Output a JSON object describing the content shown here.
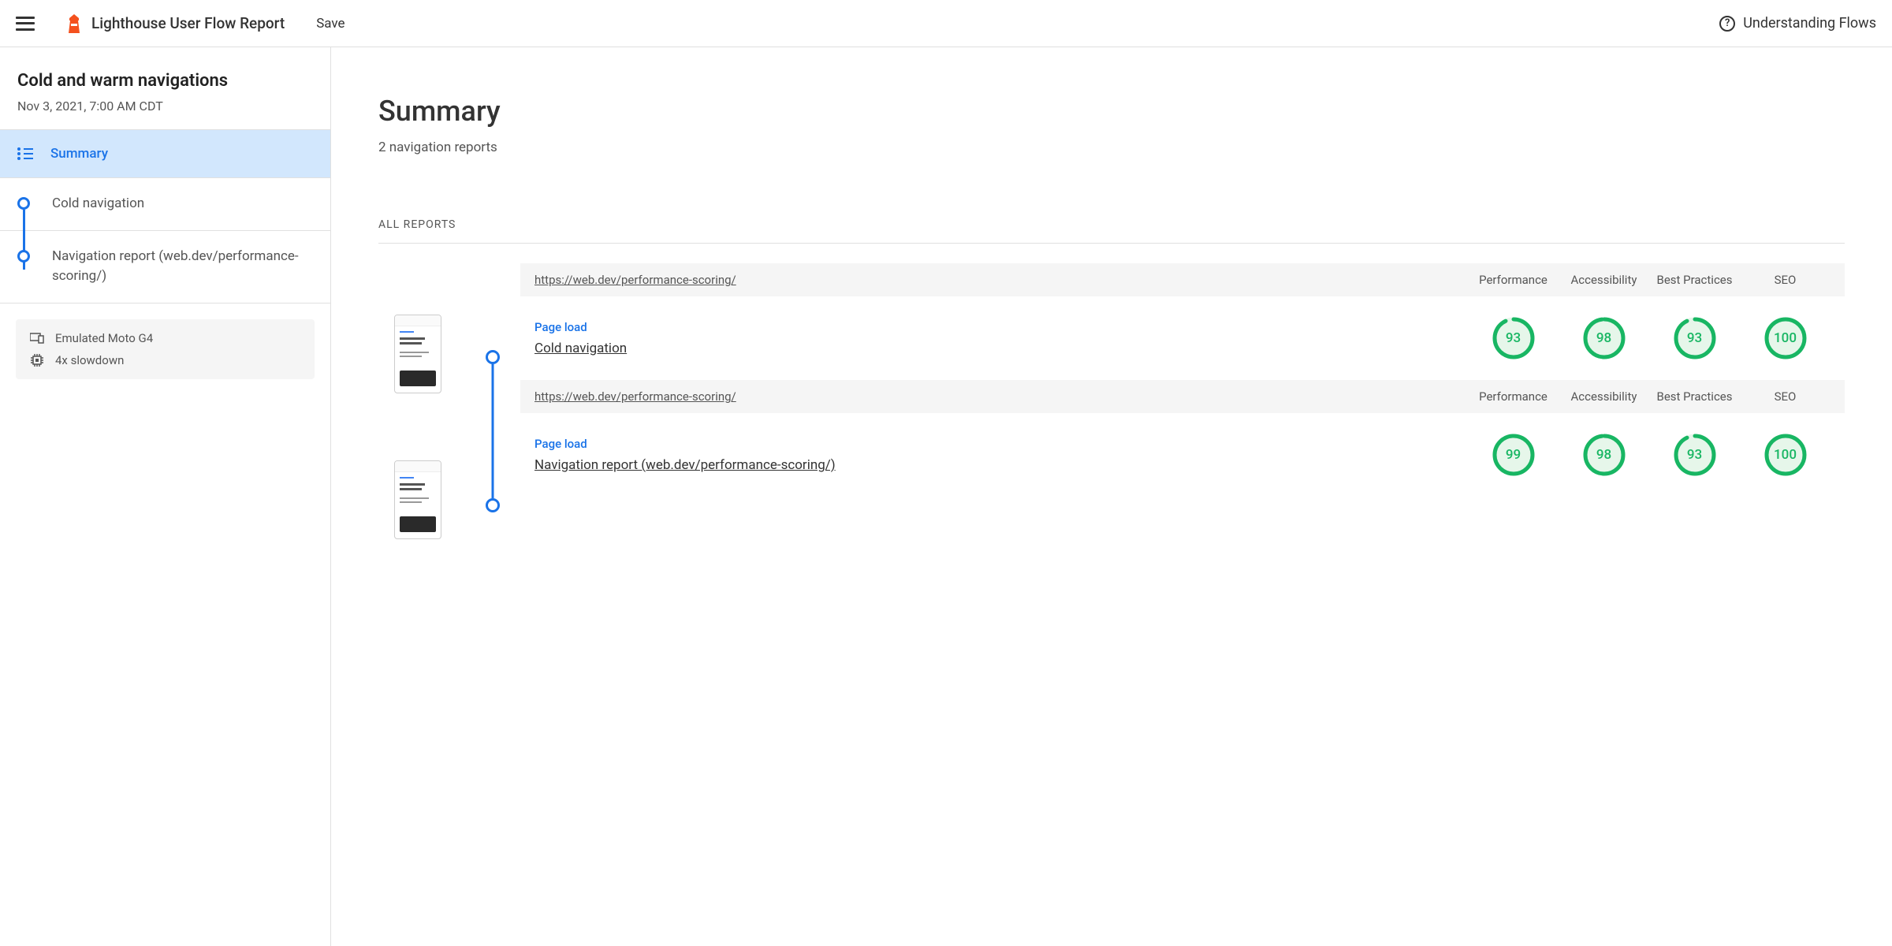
{
  "header": {
    "app_title": "Lighthouse User Flow Report",
    "save_label": "Save",
    "help_label": "Understanding Flows"
  },
  "sidebar": {
    "title": "Cold and warm navigations",
    "date": "Nov 3, 2021, 7:00 AM CDT",
    "summary_label": "Summary",
    "nav_items": [
      {
        "label": "Cold navigation"
      },
      {
        "label": "Navigation report (web.dev/performance-scoring/)"
      }
    ],
    "meta": {
      "device": "Emulated Moto G4",
      "cpu": "4x slowdown"
    }
  },
  "main": {
    "title": "Summary",
    "subtitle": "2 navigation reports",
    "all_reports_label": "ALL REPORTS",
    "columns": [
      "Performance",
      "Accessibility",
      "Best Practices",
      "SEO"
    ],
    "reports": [
      {
        "url": "https://web.dev/performance-scoring/",
        "type_label": "Page load",
        "name": "Cold navigation",
        "scores": [
          93,
          98,
          93,
          100
        ]
      },
      {
        "url": "https://web.dev/performance-scoring/",
        "type_label": "Page load",
        "name": "Navigation report (web.dev/performance-scoring/)",
        "scores": [
          99,
          98,
          93,
          100
        ]
      }
    ]
  },
  "colors": {
    "accent": "#1a73e8",
    "pass": "#18b663",
    "pass_bg": "#e6f6ea"
  }
}
